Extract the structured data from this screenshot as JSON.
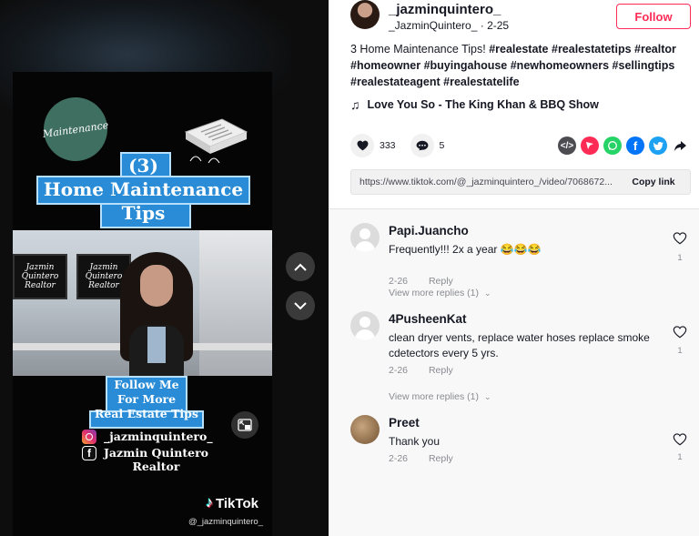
{
  "video": {
    "maintenance_badge": "Maintenance",
    "title_line1": "(3)",
    "title_line2": "Home Maintenance",
    "title_line3": "Tips",
    "follow_line1": "Follow Me",
    "follow_line2": "For More",
    "follow_line3": "Real Estate Tips",
    "instagram_handle": "_jazminquintero_",
    "facebook_line1": "Jazmin Quintero",
    "facebook_line2": "Realtor",
    "monitor_text": "Jazmin Quintero Realtor",
    "tiktok_brand": "TikTok",
    "tiktok_handle": "@_jazminquintero_"
  },
  "post": {
    "username": "_jazminquintero_",
    "display_name": "_JazminQuintero_",
    "date": "2-25",
    "follow_label": "Follow",
    "description_text": "3 Home Maintenance Tips!",
    "hashtags": "#realestate #realestatetips #realtor #homeowner #buyingahouse #newhomeowners #sellingtips #realestateagent #realestatelife",
    "music": "Love You So - The King Khan & BBQ Show",
    "like_count": "333",
    "comment_count": "5",
    "link_url": "https://www.tiktok.com/@_jazminquintero_/video/7068672...",
    "copy_link_label": "Copy link"
  },
  "comments": [
    {
      "name": "Papi.Juancho",
      "text": "Frequently!!! 2x a year 😂😂😂",
      "date": "2-26",
      "reply": "Reply",
      "likes": "1",
      "more": "View more replies (1)"
    },
    {
      "name": "4PusheenKat",
      "text": "clean dryer vents, replace water hoses replace smoke cdetectors every 5 yrs.",
      "date": "2-26",
      "reply": "Reply",
      "likes": "1",
      "more": "View more replies (1)"
    },
    {
      "name": "Preet",
      "text": "Thank you",
      "date": "2-26",
      "reply": "Reply",
      "likes": "1"
    }
  ],
  "colors": {
    "accent": "#fe2c55",
    "title_box": "#2a8cd6",
    "badge": "#3f6f60"
  },
  "icons": [
    "heart-icon",
    "comment-icon",
    "embed-icon",
    "send-icon",
    "whatsapp-icon",
    "facebook-icon",
    "twitter-icon",
    "share-arrow-icon",
    "chevron-up-icon",
    "chevron-down-icon",
    "pip-icon",
    "music-note-icon"
  ]
}
